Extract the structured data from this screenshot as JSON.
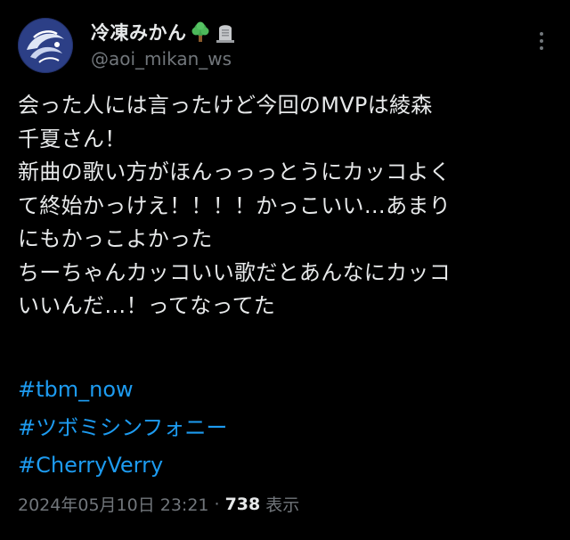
{
  "author": {
    "display_name": "冷凍みかん",
    "emoji_1": "tree-icon",
    "emoji_2": "headstone-icon",
    "handle": "@aoi_mikan_ws"
  },
  "post": {
    "text": "会った人には言ったけど今回のMVPは綾森\n千夏さん！\n新曲の歌い方がほんっっっとうにカッコよく\nて終始かっけえ！！！！かっこいい…あまり\nにもかっこよかった\nちーちゃんカッコいい歌だとあんなにカッコ\nいいんだ…！ってなってた",
    "hashtags": [
      "#tbm_now",
      "#ツボミシンフォニー",
      "#CherryVerry"
    ]
  },
  "meta": {
    "timestamp": "2024年05月10日 23:21",
    "separator": "·",
    "views_count": "738",
    "views_label": "表示"
  },
  "colors": {
    "background": "#000000",
    "text": "#e7e9ea",
    "secondary": "#71767b",
    "link": "#1d9bf0"
  }
}
